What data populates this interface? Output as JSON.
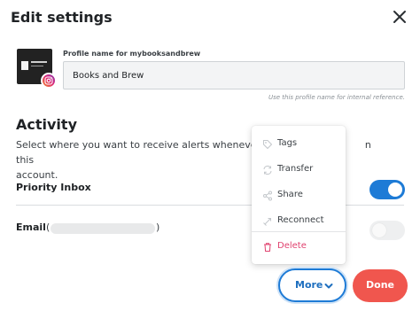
{
  "dialog": {
    "title": "Edit settings",
    "close_icon": "close-icon"
  },
  "profile": {
    "field_label": "Profile name for mybooksandbrew",
    "name_value": "Books and Brew",
    "helper_text": "Use this profile name for internal reference.",
    "network_icon": "instagram-icon"
  },
  "activity": {
    "title": "Activity",
    "description_line1": "Select where you want to receive alerts whenever th",
    "description_line1_tail": "n this",
    "description_line2": "account.",
    "priority_inbox": {
      "label": "Priority Inbox",
      "enabled": true
    },
    "email": {
      "label": "Email",
      "paren_open": "(",
      "paren_close": ")",
      "enabled": false
    }
  },
  "more_menu": {
    "items": [
      {
        "label": "Tags",
        "icon": "tag-icon"
      },
      {
        "label": "Transfer",
        "icon": "transfer-icon"
      },
      {
        "label": "Share",
        "icon": "share-icon"
      },
      {
        "label": "Reconnect",
        "icon": "reconnect-icon"
      },
      {
        "label": "Delete",
        "icon": "trash-icon"
      }
    ]
  },
  "footer": {
    "more_label": "More",
    "done_label": "Done"
  },
  "colors": {
    "accent_blue": "#1e7bd6",
    "done_red": "#f0564e",
    "delete_pink": "#e0426f"
  }
}
